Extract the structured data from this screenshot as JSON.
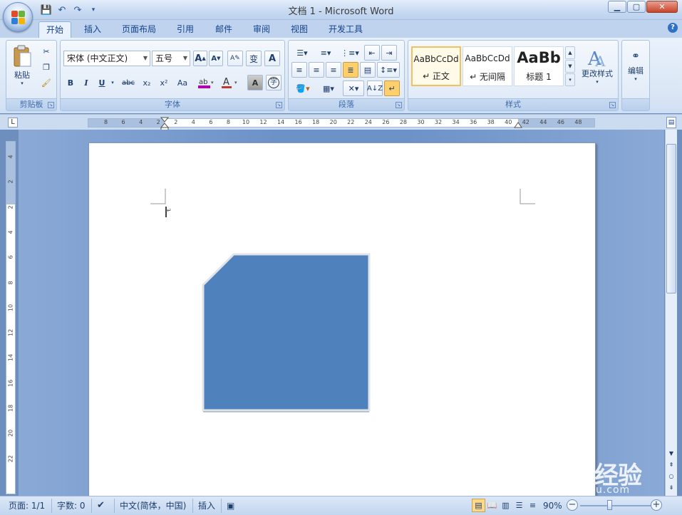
{
  "window": {
    "title": "文档 1 - Microsoft Word"
  },
  "tabs": [
    {
      "label": "开始",
      "active": true
    },
    {
      "label": "插入"
    },
    {
      "label": "页面布局"
    },
    {
      "label": "引用"
    },
    {
      "label": "邮件"
    },
    {
      "label": "审阅"
    },
    {
      "label": "视图"
    },
    {
      "label": "开发工具"
    }
  ],
  "clipboard": {
    "paste_label": "粘贴",
    "group_label": "剪贴板"
  },
  "font": {
    "font_name": "宋体 (中文正文)",
    "font_size": "五号",
    "group_label": "字体",
    "bold": "B",
    "italic": "I",
    "underline": "U",
    "strike": "abc",
    "subscript": "x₂",
    "superscript": "x²",
    "case": "Aa"
  },
  "paragraph": {
    "group_label": "段落"
  },
  "styles": {
    "group_label": "样式",
    "items": [
      {
        "sample": "AaBbCcDd",
        "name": "↵ 正文",
        "selected": true
      },
      {
        "sample": "AaBbCcDd",
        "name": "↵ 无间隔"
      },
      {
        "sample": "AaBb",
        "name": "标题 1"
      }
    ],
    "change_label": "更改样式"
  },
  "editing": {
    "label": "编辑"
  },
  "ruler": {
    "h_ticks": [
      "8",
      "6",
      "4",
      "2",
      "2",
      "4",
      "6",
      "8",
      "10",
      "12",
      "14",
      "16",
      "18",
      "20",
      "22",
      "24",
      "26",
      "28",
      "30",
      "32",
      "34",
      "36",
      "38",
      "40",
      "42",
      "44",
      "46",
      "48"
    ],
    "v_ticks": [
      "4",
      "2",
      "2",
      "4",
      "6",
      "8",
      "10",
      "12",
      "14",
      "16",
      "18",
      "20",
      "22"
    ]
  },
  "shape": {
    "fill": "#4f81bd",
    "outline": "#e0e4ea"
  },
  "status": {
    "page": "页面: 1/1",
    "words": "字数: 0",
    "language": "中文(简体，中国)",
    "mode": "插入",
    "zoom": "90%"
  },
  "watermark": {
    "main": "Baidu经验",
    "sub": "jingyan.baidu.com"
  },
  "colors": {
    "accent": "#15428b",
    "highlight": "#ffe680",
    "font_red": "#c0392b"
  }
}
